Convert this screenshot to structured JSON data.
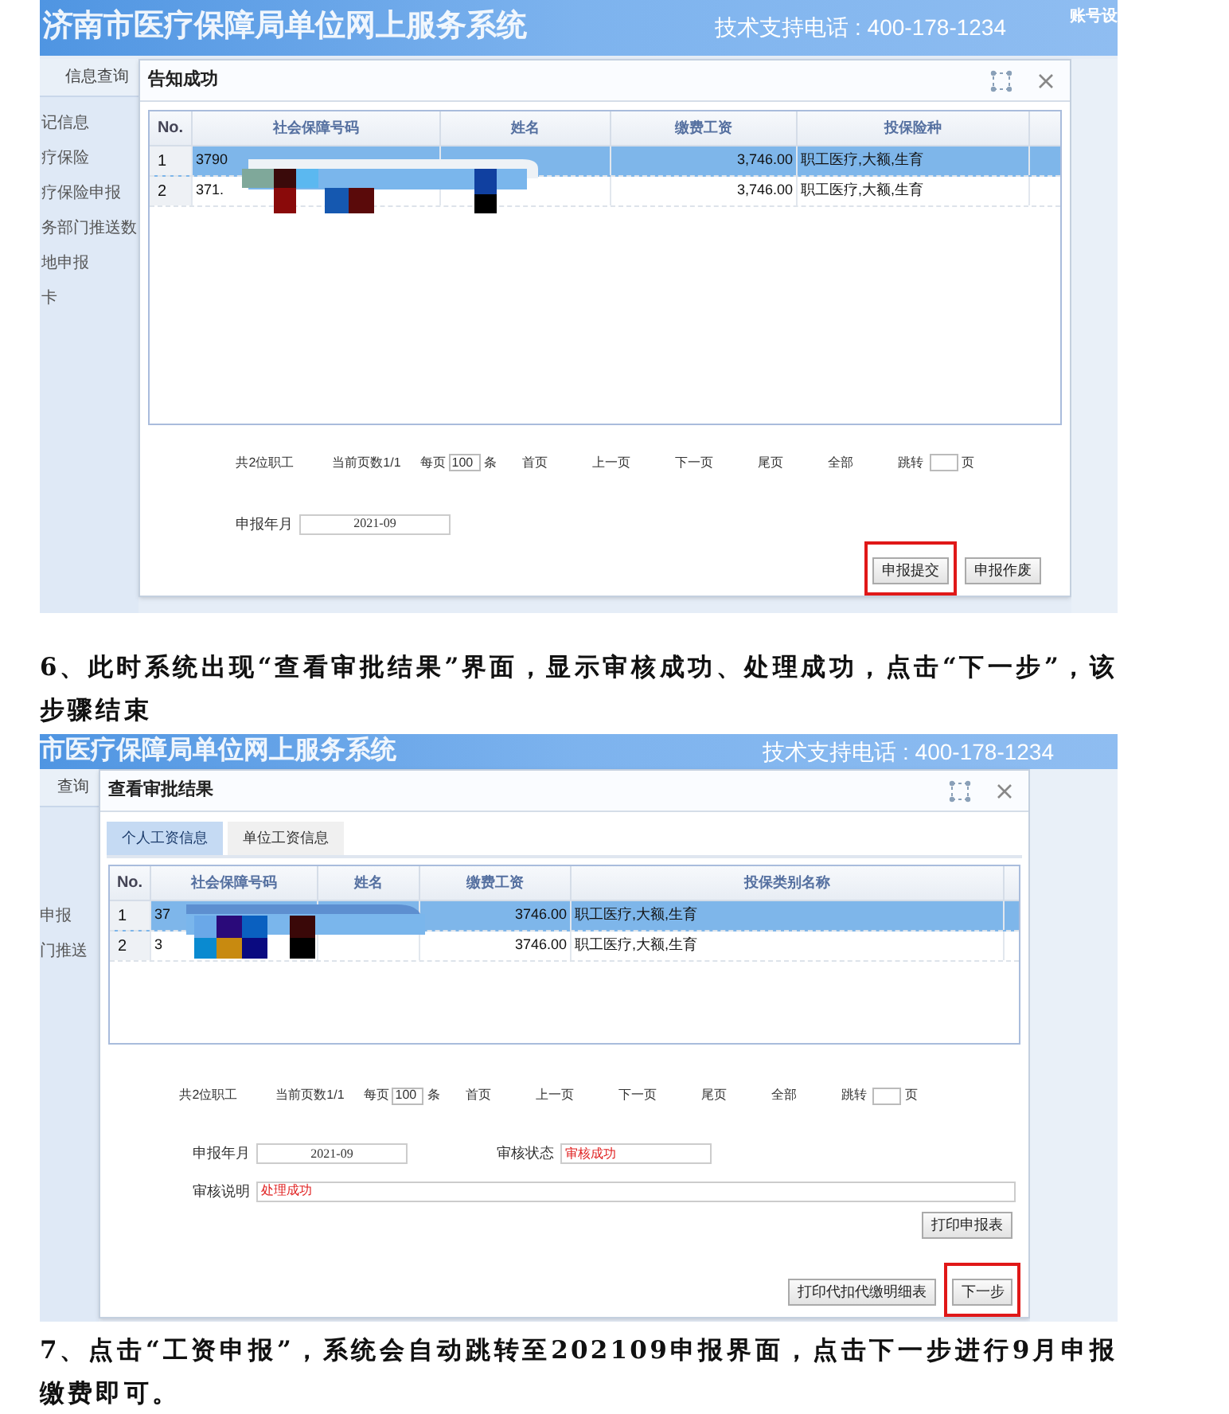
{
  "figure_1": {
    "header": {
      "title": "济南市医疗保障局单位网上服务系统",
      "support": "技术支持电话 : 400-178-1234",
      "account": "账号设"
    },
    "nav_tab": "信息查询",
    "sidebar_items": [
      "记信息",
      "疗保险",
      "疗保险申报",
      "务部门推送数",
      "地申报",
      "卡"
    ],
    "dialog": {
      "title": "告知成功",
      "columns": [
        "No.",
        "社会保障号码",
        "姓名",
        "缴费工资",
        "投保险种"
      ],
      "rows": [
        {
          "no": "1",
          "id": "3790",
          "wage": "3,746.00",
          "insurance": "职工医疗,大额,生育",
          "selected": true
        },
        {
          "no": "2",
          "id": "371.",
          "wage": "3,746.00",
          "insurance": "职工医疗,大额,生育",
          "selected": false
        }
      ],
      "pager": {
        "total": "共2位职工",
        "page": "当前页数1/1",
        "per_page_label": "每页",
        "per_page": "100",
        "per_page_unit": "条",
        "links": [
          "首页",
          "上一页",
          "下一页",
          "尾页",
          "全部"
        ],
        "jump_label": "跳转",
        "jump_unit": "页"
      },
      "fields": [
        {
          "label": "申报年月",
          "value": "2021-09",
          "kind": "date"
        }
      ],
      "buttons": [
        {
          "label": "申报提交",
          "highlighted": true
        },
        {
          "label": "申报作废",
          "highlighted": false
        }
      ]
    }
  },
  "step_6": "6、此时系统出现“查看审批结果”界面，显示审核成功、处理成功，点击“下一步”，该步骤结束",
  "figure_2": {
    "header": {
      "title": "市医疗保障局单位网上服务系统",
      "support": "技术支持电话 : 400-178-1234"
    },
    "nav_tab": "查询",
    "sidebar_items": [
      "申报",
      "门推送"
    ],
    "dialog": {
      "title": "查看审批结果",
      "tabs": [
        {
          "label": "个人工资信息",
          "selected": true
        },
        {
          "label": "单位工资信息",
          "selected": false
        }
      ],
      "columns": [
        "No.",
        "社会保障号码",
        "姓名",
        "缴费工资",
        "投保类别名称"
      ],
      "rows": [
        {
          "no": "1",
          "id": "37",
          "wage": "3746.00",
          "insurance": "职工医疗,大额,生育",
          "selected": true
        },
        {
          "no": "2",
          "id": "3",
          "wage": "3746.00",
          "insurance": "职工医疗,大额,生育",
          "selected": false
        }
      ],
      "pager": {
        "total": "共2位职工",
        "page": "当前页数1/1",
        "per_page_label": "每页",
        "per_page": "100",
        "per_page_unit": "条",
        "links": [
          "首页",
          "上一页",
          "下一页",
          "尾页",
          "全部"
        ],
        "jump_label": "跳转",
        "jump_unit": "页"
      },
      "fields": [
        {
          "label": "申报年月",
          "value": "2021-09",
          "kind": "date"
        },
        {
          "label": "审核状态",
          "value": "审核成功",
          "kind": "status"
        },
        {
          "label": "审核说明",
          "value": "处理成功",
          "kind": "status"
        }
      ],
      "print_button": "打印申报表",
      "buttons": [
        {
          "label": "打印代扣代缴明细表",
          "highlighted": false
        },
        {
          "label": "下一步",
          "highlighted": true
        }
      ]
    }
  },
  "step_7": "7、点击“工资申报”，系统会自动跳转至202109申报界面，点击下一步进行9月申报缴费即可。"
}
